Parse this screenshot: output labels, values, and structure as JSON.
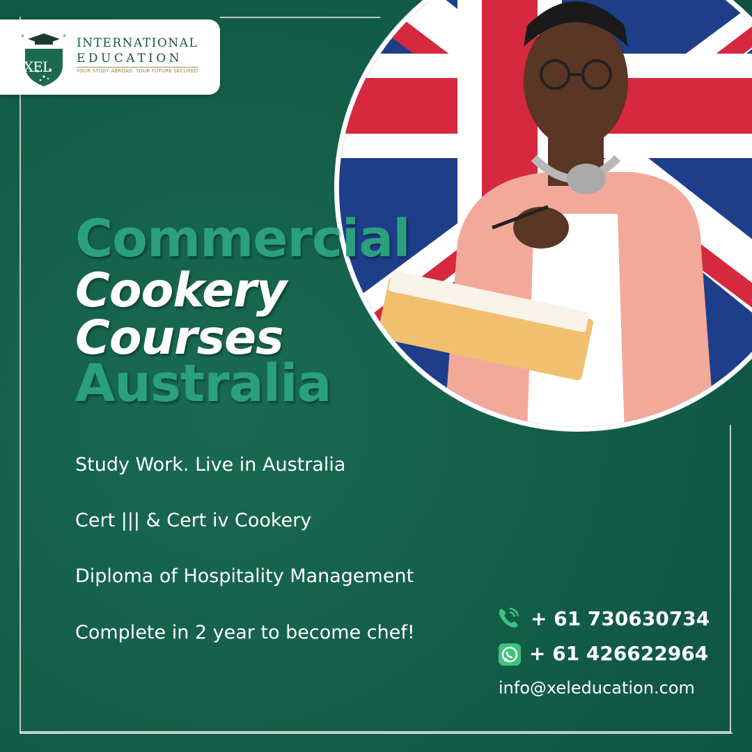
{
  "brand": {
    "logo_letters": "XEL",
    "name_line1": "INTERNATIONAL",
    "name_line2": "EDUCATION",
    "tagline": "YOUR STUDY ABROAD. YOUR FUTURE SECURED"
  },
  "headline": {
    "line1": "Commercial",
    "line2": "Cookery",
    "line3": "Courses",
    "line4": "Australia"
  },
  "bullets": [
    "Study Work. Live in Australia",
    "Cert ||| & Cert iv Cookery",
    "Diploma of Hospitality Management",
    "Complete in 2 year to become chef!"
  ],
  "contact": {
    "phone": "+ 61 730630734",
    "whatsapp": "+ 61 426622964",
    "email": "info@xeleducation.com",
    "phone_icon": "phone-call-icon",
    "whatsapp_icon": "whatsapp-icon"
  },
  "colors": {
    "background": "#145f49",
    "headline_green": "#2aa07d",
    "white": "#ffffff",
    "flag_blue": "#1f3e8a",
    "flag_red": "#d6283e",
    "icon_green": "#3cc47a"
  }
}
